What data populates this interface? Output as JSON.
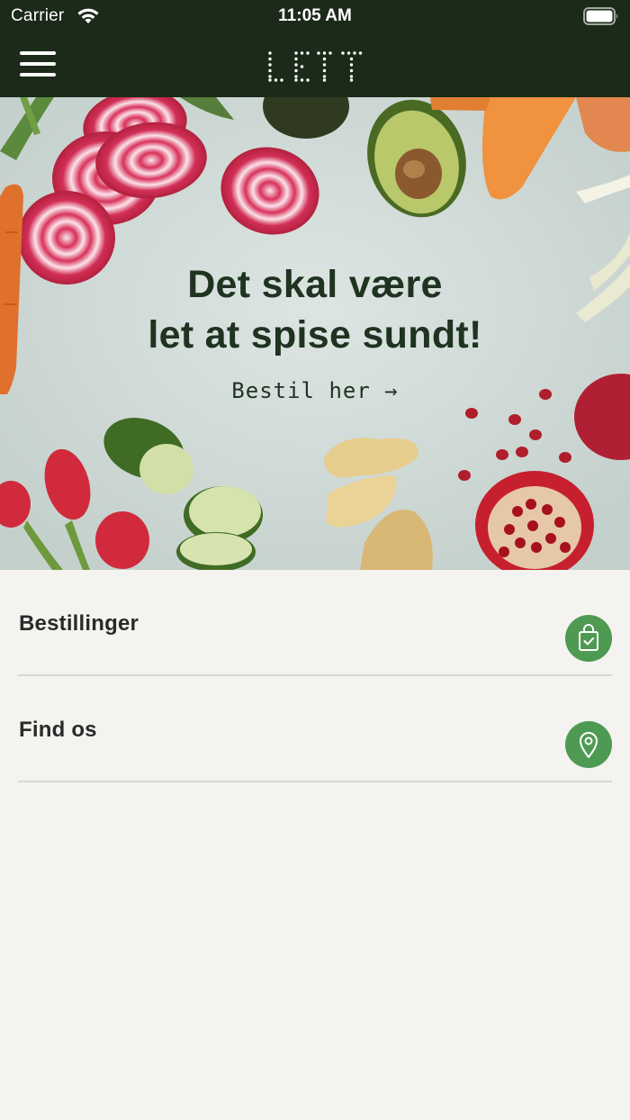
{
  "status_bar": {
    "carrier": "Carrier",
    "time": "11:05 AM",
    "icons": [
      "wifi-icon",
      "battery-icon"
    ]
  },
  "nav": {
    "menu_icon": "hamburger-menu-icon",
    "logo_text": "LETT"
  },
  "hero": {
    "headline_line1": "Det skal være",
    "headline_line2": "let at spise sundt!",
    "cta": "Bestil her →",
    "image": "vegetables-background"
  },
  "menu_items": [
    {
      "label": "Bestillinger",
      "icon": "shopping-bag-check-icon"
    },
    {
      "label": "Find os",
      "icon": "location-pin-icon"
    }
  ],
  "colors": {
    "header_bg": "#1b2a19",
    "page_bg": "#f4f3ef",
    "accent_green": "#4e9a52",
    "headline_text": "#1e3320"
  }
}
